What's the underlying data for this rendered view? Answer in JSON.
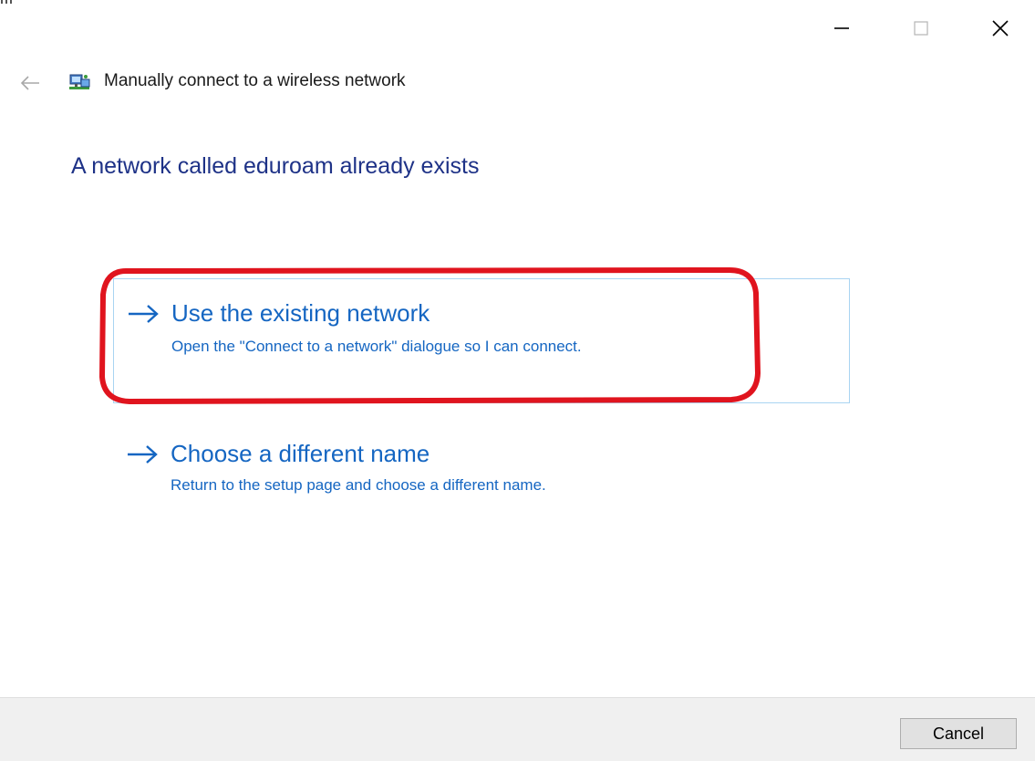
{
  "window": {
    "title": "Manually connect to a wireless network",
    "icons": {
      "back": "back-arrow-icon",
      "network": "wireless-network-icon",
      "minimize": "minimize-icon",
      "maximize": "maximize-icon",
      "close": "close-icon"
    }
  },
  "main": {
    "heading": "A network called eduroam already exists",
    "options": [
      {
        "title": "Use the existing network",
        "description": "Open the \"Connect to a network\" dialogue so I can connect.",
        "selected": true
      },
      {
        "title": "Choose a different name",
        "description": "Return to the setup page and choose a different name.",
        "selected": false
      }
    ]
  },
  "footer": {
    "cancel_label": "Cancel"
  },
  "colors": {
    "heading": "#1e3287",
    "link": "#1566c2",
    "annotation": "#e0141e",
    "selection_border": "#a9d4f2"
  }
}
